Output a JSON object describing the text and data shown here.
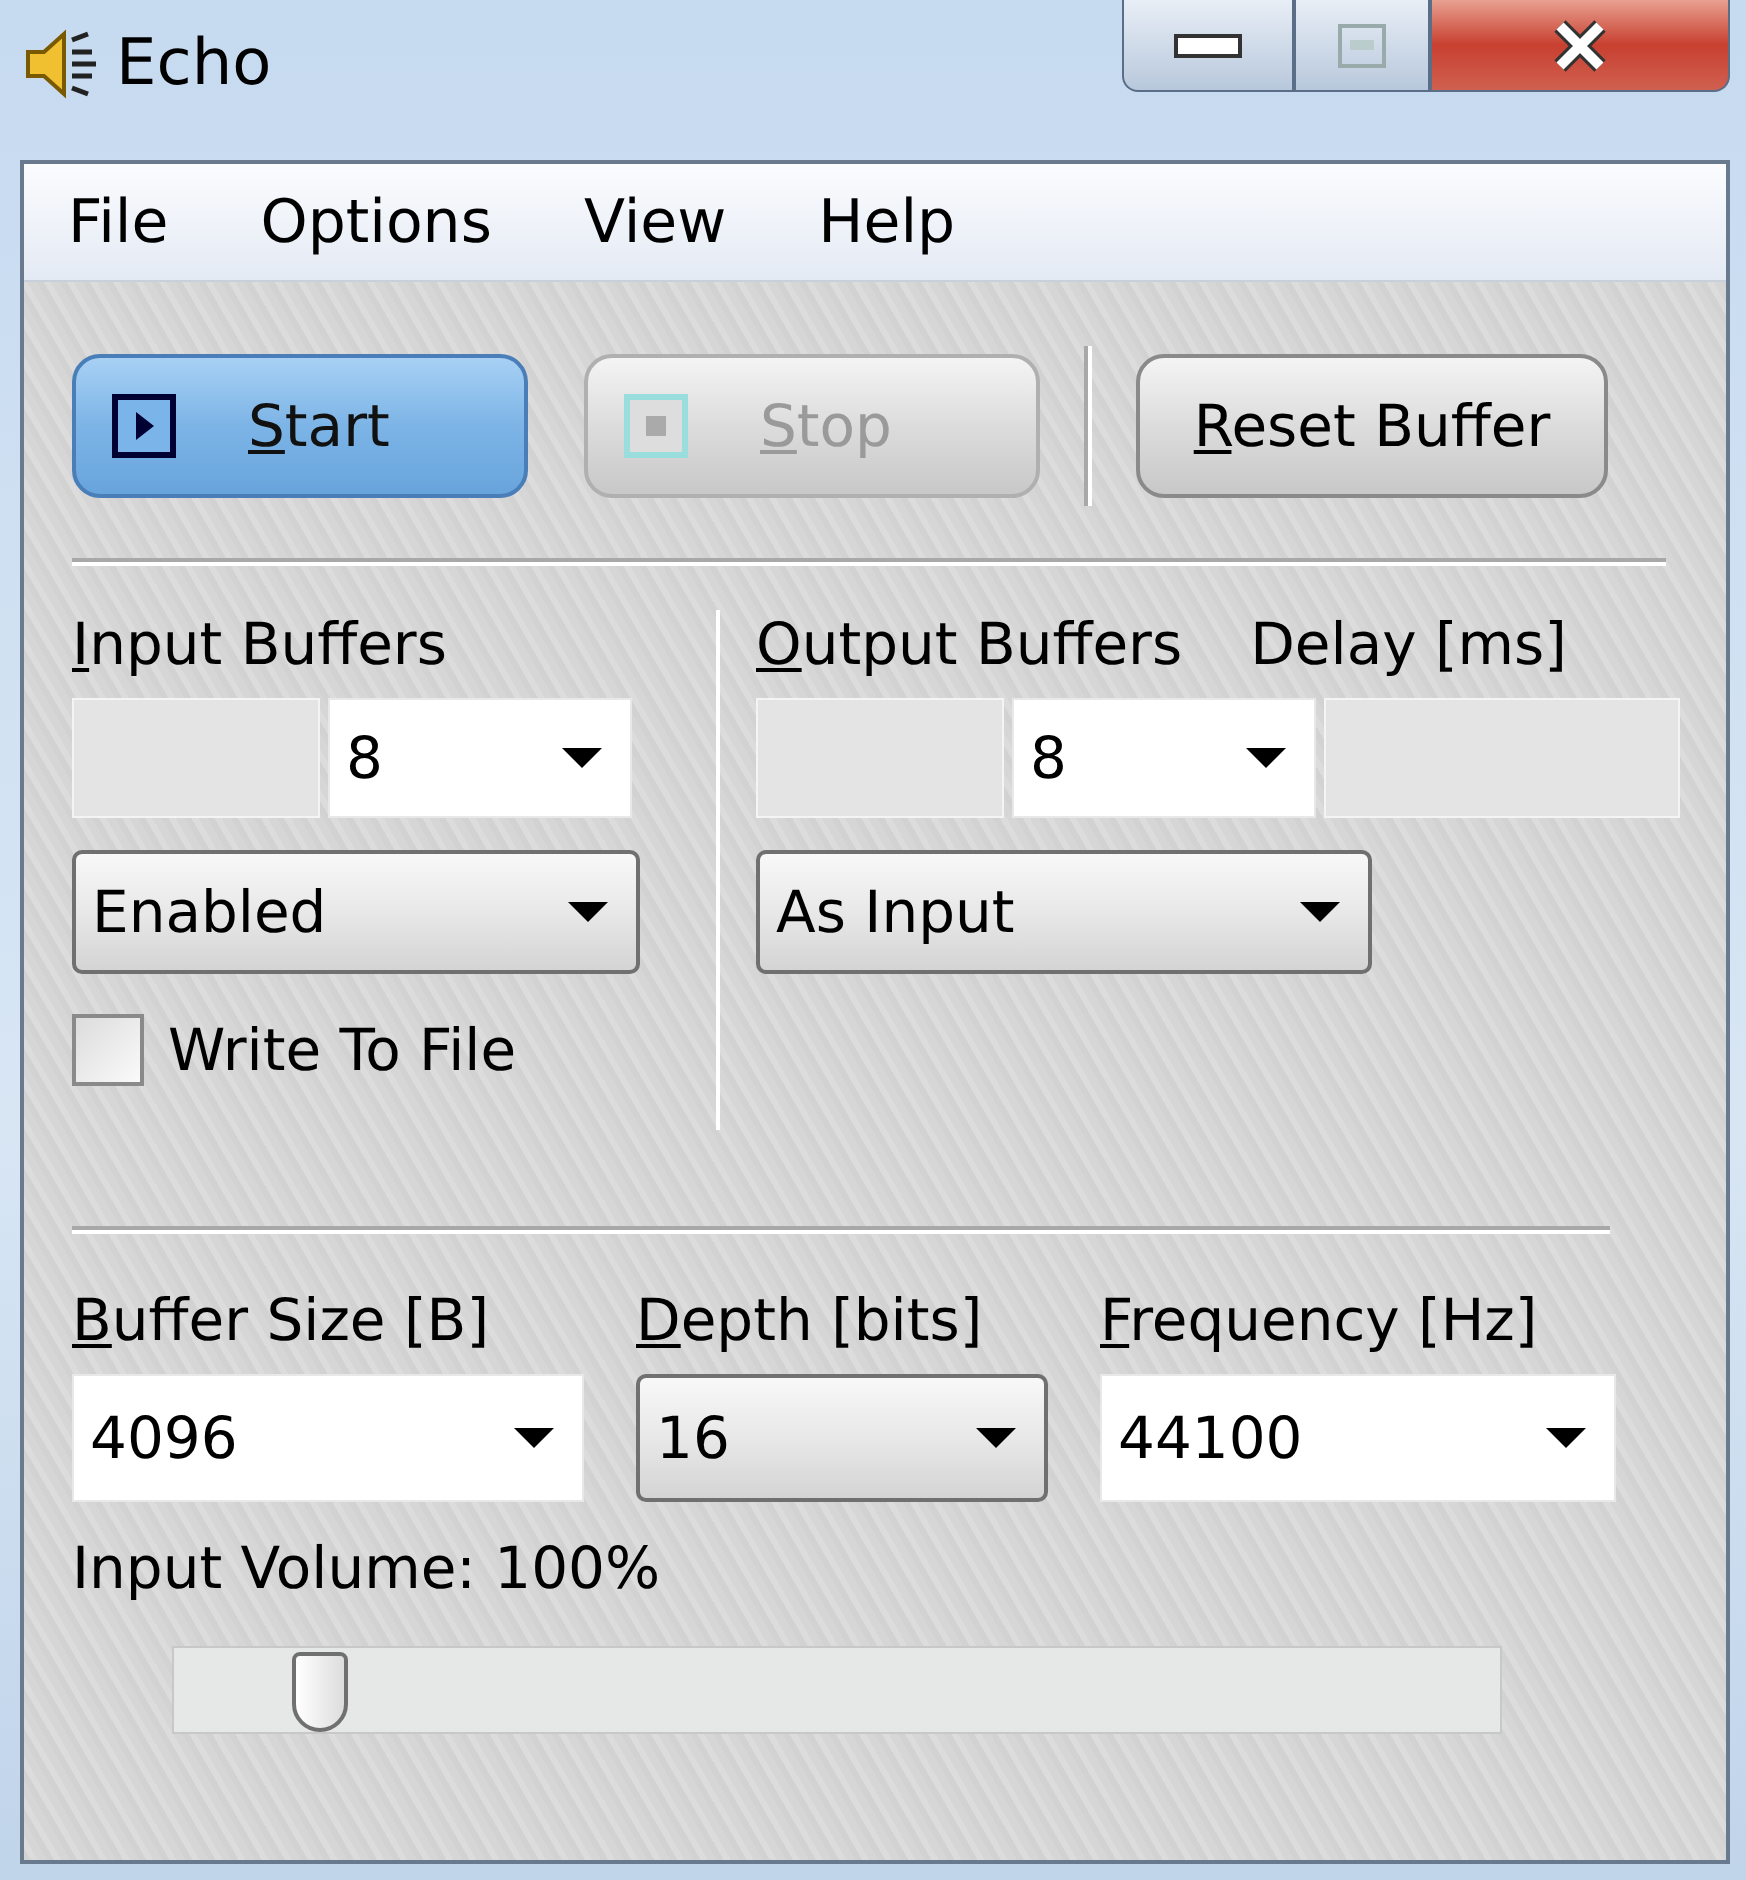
{
  "window": {
    "title": "Echo"
  },
  "menu": [
    "File",
    "Options",
    "View",
    "Help"
  ],
  "toolbar": [
    {
      "label": "Start",
      "kind": "play",
      "highlighted": true,
      "disabled": false
    },
    {
      "label": "Stop",
      "kind": "stop",
      "highlighted": false,
      "disabled": true
    },
    {
      "label": "Reset Buffer",
      "kind": "text",
      "highlighted": false,
      "disabled": false
    }
  ],
  "input_buffers": {
    "label": "Input Buffers",
    "count": "8",
    "mode": "Enabled",
    "write_to_file": {
      "label": "Write To File",
      "checked": false
    }
  },
  "output_buffers": {
    "label": "Output Buffers",
    "count": "8",
    "mode": "As Input"
  },
  "delay": {
    "label": "Delay [ms]"
  },
  "format": [
    {
      "label": "Buffer Size [B]",
      "value": "4096",
      "kind": "edit"
    },
    {
      "label": "Depth [bits]",
      "value": "16",
      "kind": "list"
    },
    {
      "label": "Frequency [Hz]",
      "value": "44100",
      "kind": "edit"
    }
  ],
  "volume": {
    "label": "Input Volume: 100%",
    "level": 0.11
  }
}
